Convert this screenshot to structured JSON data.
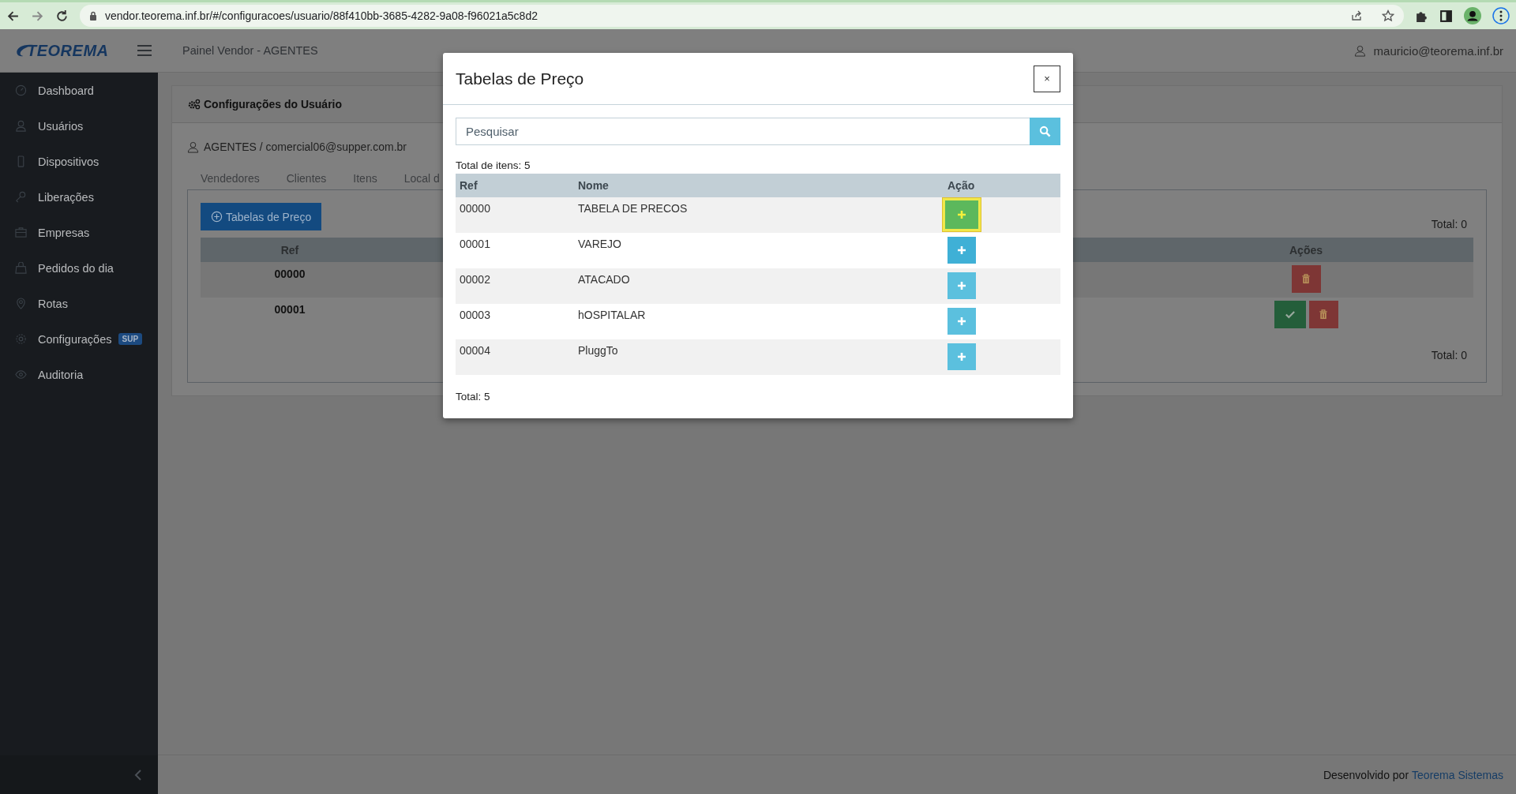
{
  "browser": {
    "url": "vendor.teorema.inf.br/#/configuracoes/usuario/88f410bb-3685-4282-9a08-f96021a5c8d2"
  },
  "header": {
    "logo": "TEOREMA",
    "title": "Painel Vendor - AGENTES",
    "user": "mauricio@teorema.inf.br"
  },
  "sidebar": {
    "items": [
      {
        "label": "Dashboard"
      },
      {
        "label": "Usuários"
      },
      {
        "label": "Dispositivos"
      },
      {
        "label": "Liberações"
      },
      {
        "label": "Empresas"
      },
      {
        "label": "Pedidos do dia"
      },
      {
        "label": "Rotas"
      },
      {
        "label": "Configurações",
        "badge": "SUP"
      },
      {
        "label": "Auditoria"
      }
    ]
  },
  "card": {
    "title": "Configurações do Usuário",
    "user_line": "AGENTES / comercial06@supper.com.br",
    "tabs": [
      {
        "label": "Vendedores",
        "selected": false
      },
      {
        "label": "Clientes",
        "selected": false
      },
      {
        "label": "Itens",
        "selected": false
      },
      {
        "label": "Local d",
        "selected": false
      }
    ],
    "add_button": "Tabelas de Preço",
    "total_top": "Total: 0",
    "total_bottom": "Total: 0",
    "table": {
      "columns": [
        "Ref",
        "Ações"
      ],
      "rows": [
        {
          "ref": "00000",
          "actions": [
            {
              "kind": "delete"
            }
          ]
        },
        {
          "ref": "00001",
          "actions": [
            {
              "kind": "approve"
            },
            {
              "kind": "delete"
            }
          ]
        }
      ]
    }
  },
  "modal": {
    "title": "Tabelas de Preço",
    "close": "×",
    "search": {
      "placeholder": "Pesquisar"
    },
    "total_items": "Total de itens: 5",
    "columns": [
      "Ref",
      "Nome",
      "Ação"
    ],
    "rows": [
      {
        "ref": "00000",
        "name": "TABELA DE PRECOS",
        "focused": true,
        "hovered": false
      },
      {
        "ref": "00001",
        "name": "VAREJO",
        "focused": false,
        "hovered": true
      },
      {
        "ref": "00002",
        "name": "ATACADO",
        "focused": false,
        "hovered": false
      },
      {
        "ref": "00003",
        "name": "hOSPITALAR",
        "focused": false,
        "hovered": false
      },
      {
        "ref": "00004",
        "name": "PluggTo",
        "focused": false,
        "hovered": false
      }
    ],
    "total": "Total: 5"
  },
  "footer": {
    "text": "Desenvolvido por",
    "link": "Teorema Sistemas"
  }
}
